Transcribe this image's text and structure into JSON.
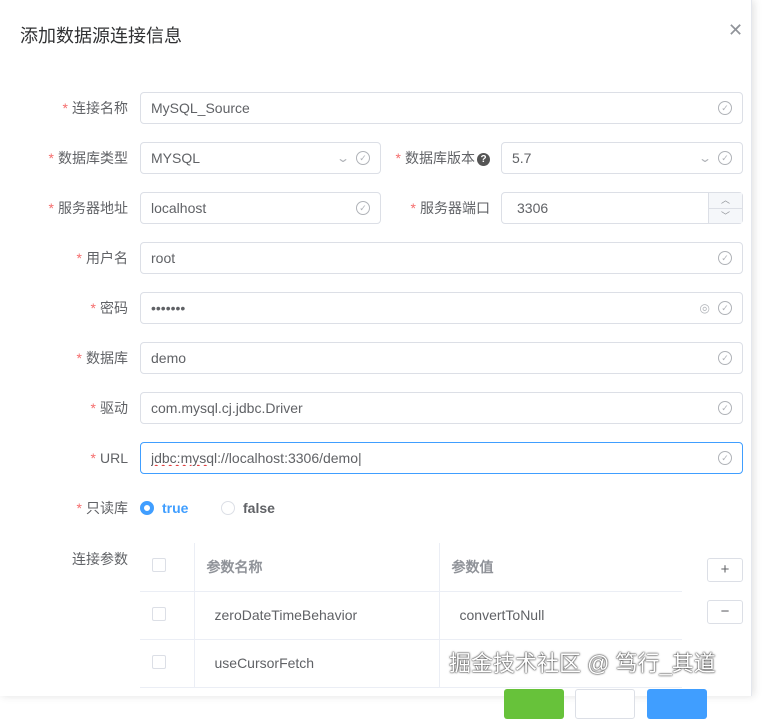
{
  "title": "添加数据源连接信息",
  "fields": {
    "name": {
      "label": "连接名称",
      "value": "MySQL_Source"
    },
    "db_type": {
      "label": "数据库类型",
      "value": "MYSQL"
    },
    "db_version": {
      "label": "数据库版本",
      "value": "5.7"
    },
    "host": {
      "label": "服务器地址",
      "value": "localhost"
    },
    "port": {
      "label": "服务器端口",
      "value": "3306"
    },
    "user": {
      "label": "用户名",
      "value": "root"
    },
    "password": {
      "label": "密码",
      "value": "•••••••"
    },
    "database": {
      "label": "数据库",
      "value": "demo"
    },
    "driver": {
      "label": "驱动",
      "value": "com.mysql.cj.jdbc.Driver"
    },
    "url": {
      "label": "URL",
      "value_a": "jdbc:mysql",
      "value_b": "://localhost:3306/demo"
    },
    "readonly": {
      "label": "只读库",
      "options": [
        "true",
        "false"
      ],
      "selected": "true"
    }
  },
  "params": {
    "label": "连接参数",
    "headers": [
      "参数名称",
      "参数值"
    ],
    "rows": [
      {
        "name": "zeroDateTimeBehavior",
        "value": "convertToNull"
      },
      {
        "name": "useCursorFetch",
        "value": ""
      }
    ],
    "add": "+",
    "remove": "−"
  },
  "watermark": "掘金技术社区 @ 笃行_其道",
  "colors": {
    "primary": "#409eff",
    "success": "#67c23a",
    "required": "#f56c6c"
  }
}
